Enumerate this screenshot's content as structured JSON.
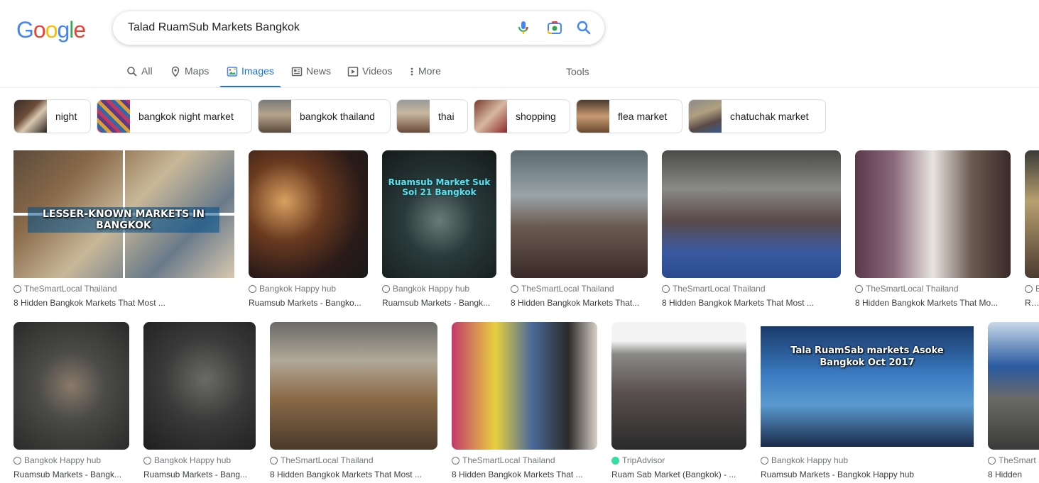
{
  "logo": {
    "letters": [
      "G",
      "o",
      "o",
      "g",
      "l",
      "e"
    ],
    "colors": [
      "#4285f4",
      "#ea4335",
      "#fbbc05",
      "#4285f4",
      "#34a853",
      "#ea4335"
    ]
  },
  "search": {
    "query": "Talad RuamSub Markets Bangkok"
  },
  "tabs": [
    {
      "label": "All",
      "icon": "search-icon"
    },
    {
      "label": "Maps",
      "icon": "map-pin-icon"
    },
    {
      "label": "Images",
      "icon": "image-icon",
      "active": true
    },
    {
      "label": "News",
      "icon": "news-icon"
    },
    {
      "label": "Videos",
      "icon": "video-icon"
    },
    {
      "label": "More",
      "icon": "more-vert-icon"
    }
  ],
  "tools_label": "Tools",
  "chips": [
    "night",
    "bangkok night market",
    "bangkok thailand",
    "thai",
    "shopping",
    "flea market",
    "chatuchak market"
  ],
  "results_row1": [
    {
      "source": "TheSmartLocal Thailand",
      "title": "8 Hidden Bangkok Markets That Most ...",
      "overlay": "LESSER-KNOWN MARKETS IN BANGKOK"
    },
    {
      "source": "Bangkok Happy hub",
      "title": "Ruamsub Markets - Bangko..."
    },
    {
      "source": "Bangkok Happy hub",
      "title": "Ruamsub Markets - Bangk...",
      "overlay": "Ruamsub Market Suk Soi 21 Bangkok"
    },
    {
      "source": "TheSmartLocal Thailand",
      "title": "8 Hidden Bangkok Markets That..."
    },
    {
      "source": "TheSmartLocal Thailand",
      "title": "8 Hidden Bangkok Markets That Most ..."
    },
    {
      "source": "TheSmartLocal Thailand",
      "title": "8 Hidden Bangkok Markets That Mo..."
    },
    {
      "source": "B",
      "title": "Rua"
    }
  ],
  "results_row2": [
    {
      "source": "Bangkok Happy hub",
      "title": "Ruamsub Markets - Bangk..."
    },
    {
      "source": "Bangkok Happy hub",
      "title": "Ruamsub Markets - Bang..."
    },
    {
      "source": "TheSmartLocal Thailand",
      "title": "8 Hidden Bangkok Markets That Most ..."
    },
    {
      "source": "TheSmartLocal Thailand",
      "title": "8 Hidden Bangkok Markets That ..."
    },
    {
      "source": "TripAdvisor",
      "title": "Ruam Sab Market (Bangkok) - ..."
    },
    {
      "source": "Bangkok Happy hub",
      "title": "Ruamsub Markets - Bangkok Happy hub",
      "overlay": "Tala RuamSab markets Asoke Bangkok Oct 2017"
    },
    {
      "source": "TheSmart",
      "title": "8 Hidden"
    }
  ]
}
